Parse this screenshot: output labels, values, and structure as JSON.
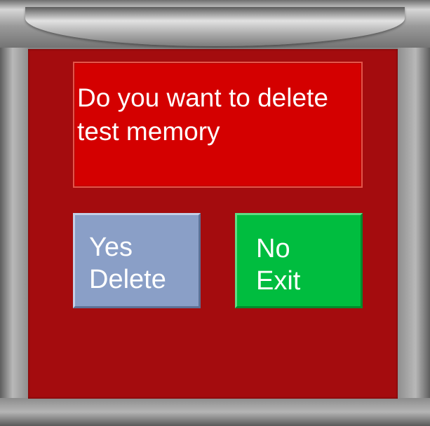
{
  "dialog": {
    "message": "Do you want to delete\ntest memory"
  },
  "buttons": {
    "yes": {
      "line1": "Yes",
      "line2": "Delete"
    },
    "no": {
      "line1": "No",
      "line2": "Exit"
    }
  },
  "colors": {
    "panel": "#a40c0e",
    "message_box": "#d40000",
    "yes_button": "#8a9fc7",
    "no_button": "#00bd3f",
    "frame": "#9a9a9a"
  }
}
